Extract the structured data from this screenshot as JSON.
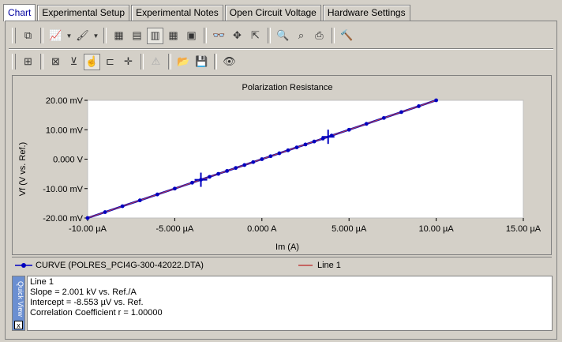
{
  "tabs": [
    {
      "label": "Chart",
      "active": true
    },
    {
      "label": "Experimental Setup",
      "active": false
    },
    {
      "label": "Experimental Notes",
      "active": false
    },
    {
      "label": "Open Circuit Voltage",
      "active": false
    },
    {
      "label": "Hardware Settings",
      "active": false
    }
  ],
  "toolbar_icons": {
    "row1": [
      "copy-icon",
      "line-chart-icon",
      "dropdown-arrow-icon",
      "fill-color-icon",
      "dropdown-arrow-icon",
      "layout-a-icon",
      "layout-b-icon",
      "layout-c-icon",
      "table-icon",
      "chart-view-icon",
      "glasses-icon",
      "move-icon",
      "export-icon",
      "zoom-icon",
      "zoom-fit-icon",
      "print-icon",
      "hammer-icon"
    ],
    "row2": [
      "settings-icon",
      "cursor-x-icon",
      "cursor-y-icon",
      "hand-select-icon",
      "range-icon",
      "crosshair-icon",
      "warning-icon",
      "open-folder-icon",
      "save-icon",
      "eye-icon"
    ]
  },
  "chart_data": {
    "type": "scatter",
    "title": "Polarization Resistance",
    "xlabel": "Im (A)",
    "ylabel": "Vf (V vs. Ref.)",
    "x_tick_labels": [
      "-10.00 µA",
      "-5.000 µA",
      "0.000 A",
      "5.000 µA",
      "10.00 µA",
      "15.00 µA"
    ],
    "y_tick_labels": [
      "20.00 mV",
      "10.00 mV",
      "0.000 V",
      "-10.00 mV",
      "-20.00 mV"
    ],
    "x_unit_scale": "µA",
    "xlim": [
      -10,
      15
    ],
    "ylim": [
      -20,
      20
    ],
    "series": [
      {
        "name": "CURVE (POLRES_PCI4G-300-42022.DTA)",
        "color": "#0000c0",
        "marker": "circle",
        "x": [
          -10.0,
          -9.0,
          -8.0,
          -7.0,
          -6.0,
          -5.0,
          -4.0,
          -3.5,
          -3.0,
          -2.5,
          -2.0,
          -1.5,
          -1.0,
          -0.5,
          0.0,
          0.5,
          1.0,
          1.5,
          2.0,
          2.5,
          3.0,
          3.5,
          4.0,
          5.0,
          6.0,
          7.0,
          8.0,
          9.0,
          10.0
        ],
        "y": [
          -20.0,
          -18.0,
          -16.0,
          -14.0,
          -12.0,
          -10.0,
          -8.0,
          -7.0,
          -6.0,
          -5.0,
          -4.0,
          -3.0,
          -2.0,
          -1.0,
          0.0,
          1.0,
          2.0,
          3.0,
          4.0,
          5.0,
          6.0,
          7.0,
          8.0,
          10.0,
          12.0,
          14.0,
          16.0,
          18.0,
          20.0
        ]
      },
      {
        "name": "Line 1",
        "color": "#c04040",
        "marker": "none",
        "x": [
          -10.0,
          10.0
        ],
        "y": [
          -20.0,
          20.0
        ]
      }
    ],
    "cursors": [
      {
        "x": -3.5,
        "y": -7.0
      },
      {
        "x": 3.8,
        "y": 7.6
      }
    ],
    "grid": false
  },
  "quick_view": {
    "side_label": "Quick View",
    "close_symbol": "x",
    "lines": [
      "Line 1",
      "Slope = 2.001 kV vs. Ref./A",
      "Intercept = -8.553 µV vs. Ref.",
      "Correlation Coefficient r = 1.00000"
    ]
  }
}
